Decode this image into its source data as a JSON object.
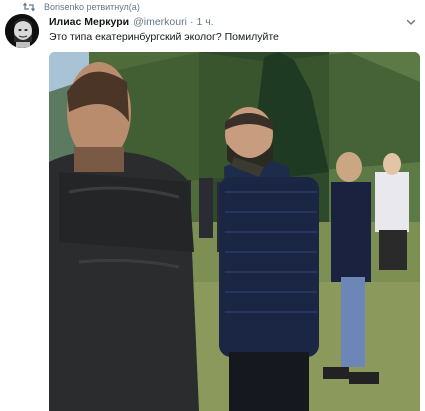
{
  "retweet": {
    "icon": "retweet-icon",
    "text": "Borisenko ретвитнул(а)"
  },
  "tweet": {
    "author": {
      "name": "Илиас Меркури",
      "handle": "@imerkouri"
    },
    "separator": "·",
    "time": "1 ч.",
    "text": "Это типа екатеринбургский эколог? Помилуйте",
    "icons": {
      "more": "chevron-down-icon"
    }
  },
  "colors": {
    "secondary_text": "#657786",
    "primary_text": "#14171a",
    "background": "#ffffff"
  }
}
